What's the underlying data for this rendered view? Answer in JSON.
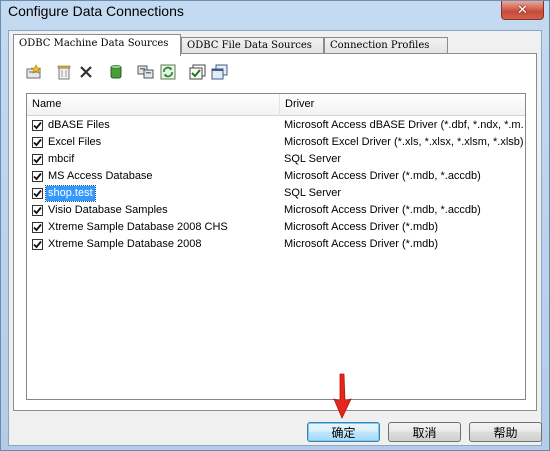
{
  "window": {
    "title": "Configure Data Connections",
    "close_glyph": "✕"
  },
  "tabs": [
    {
      "label": "ODBC Machine Data Sources",
      "active": true
    },
    {
      "label": "ODBC File Data Sources",
      "active": false
    },
    {
      "label": "Connection Profiles",
      "active": false
    }
  ],
  "toolbar": {
    "buttons": [
      {
        "name": "new-source-icon"
      },
      {
        "name": "delete-icon"
      },
      {
        "name": "remove-x-icon"
      },
      {
        "name": "database-icon"
      },
      {
        "name": "configure-icon"
      },
      {
        "name": "refresh-icon"
      },
      {
        "name": "check-all-icon"
      },
      {
        "name": "copy-icon"
      }
    ]
  },
  "list": {
    "columns": {
      "name": "Name",
      "driver": "Driver"
    },
    "rows": [
      {
        "name": "dBASE Files",
        "driver": "Microsoft Access dBASE Driver (*.dbf, *.ndx, *.m...",
        "checked": true,
        "selected": false
      },
      {
        "name": "Excel Files",
        "driver": "Microsoft Excel Driver (*.xls, *.xlsx, *.xlsm, *.xlsb)",
        "checked": true,
        "selected": false
      },
      {
        "name": "mbcif",
        "driver": "SQL Server",
        "checked": true,
        "selected": false
      },
      {
        "name": "MS Access Database",
        "driver": "Microsoft Access Driver (*.mdb, *.accdb)",
        "checked": true,
        "selected": false
      },
      {
        "name": "shop.test",
        "driver": "SQL Server",
        "checked": true,
        "selected": true
      },
      {
        "name": "Visio Database Samples",
        "driver": "Microsoft Access Driver (*.mdb, *.accdb)",
        "checked": true,
        "selected": false
      },
      {
        "name": "Xtreme Sample Database 2008 CHS",
        "driver": "Microsoft Access Driver (*.mdb)",
        "checked": true,
        "selected": false
      },
      {
        "name": "Xtreme Sample Database 2008",
        "driver": "Microsoft Access Driver (*.mdb)",
        "checked": true,
        "selected": false
      }
    ]
  },
  "buttons": {
    "ok": "确定",
    "cancel": "取消",
    "help": "帮助"
  },
  "colors": {
    "selection": "#3399ff",
    "annotation_arrow": "#e8251c"
  }
}
